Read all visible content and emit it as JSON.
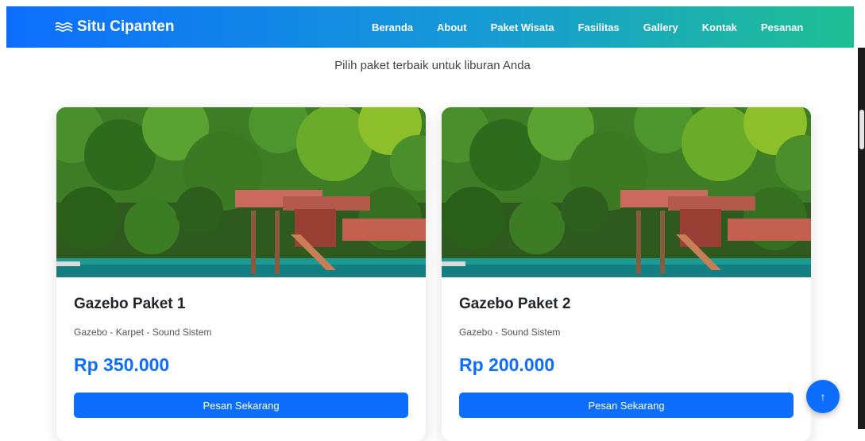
{
  "nav": {
    "brand": "Situ Cipanten",
    "links": [
      "Beranda",
      "About",
      "Paket Wisata",
      "Fasilitas",
      "Gallery",
      "Kontak",
      "Pesanan"
    ]
  },
  "section": {
    "subtitle": "Pilih paket terbaik untuk liburan Anda"
  },
  "cards": [
    {
      "title": "Gazebo Paket 1",
      "description": "Gazebo - Karpet - Sound Sistem",
      "price": "Rp 350.000",
      "button": "Pesan Sekarang"
    },
    {
      "title": "Gazebo Paket 2",
      "description": "Gazebo - Sound Sistem",
      "price": "Rp 200.000",
      "button": "Pesan Sekarang"
    }
  ],
  "scroll_top": {
    "icon": "arrow-up-icon",
    "glyph": "↑"
  },
  "colors": {
    "primary": "#0d6efd",
    "gradient_end": "#1fbf92",
    "text_dark": "#212529"
  }
}
